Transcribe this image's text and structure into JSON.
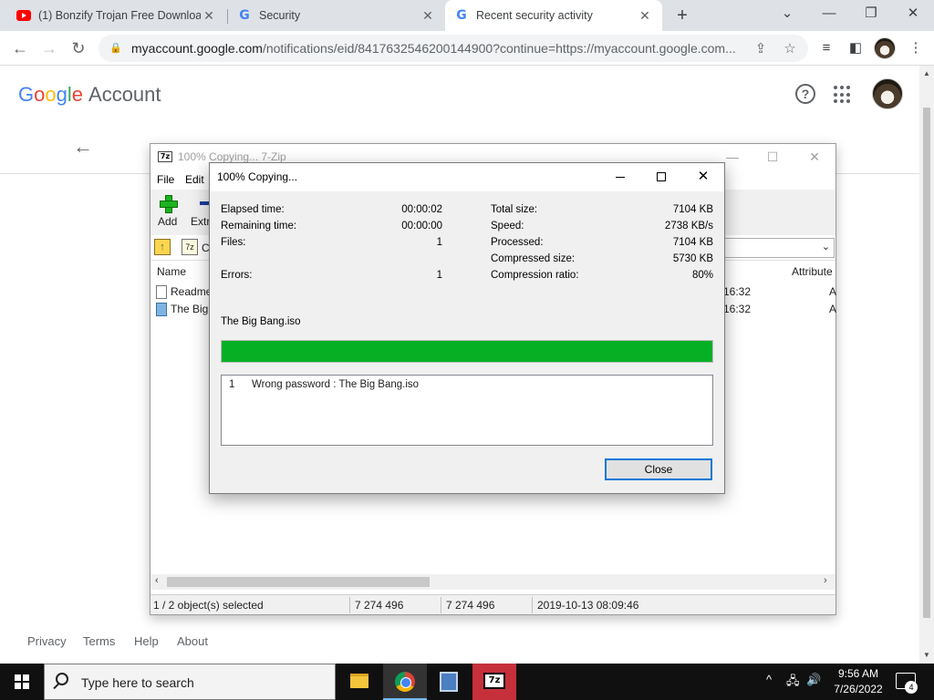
{
  "browser": {
    "tabs": [
      {
        "title": "(1) Bonzify Trojan Free Download",
        "icon": "youtube-icon",
        "active": false
      },
      {
        "title": "Security",
        "icon": "google-icon",
        "active": false
      },
      {
        "title": "Recent security activity",
        "icon": "google-icon",
        "active": true
      }
    ],
    "url_host": "myaccount.google.com",
    "url_path": "/notifications/eid/8417632546200144900?continue=https://myaccount.google.com..."
  },
  "page": {
    "logo": {
      "letters": [
        "G",
        "o",
        "o",
        "g",
        "l",
        "e"
      ],
      "suffix": "Account"
    },
    "footer": {
      "privacy": "Privacy",
      "terms": "Terms",
      "help": "Help",
      "about": "About"
    }
  },
  "zip_window": {
    "title": "100% Copying... 7-Zip",
    "logo": "7z",
    "menu": {
      "file": "File",
      "edit": "Edit"
    },
    "tools": {
      "add": "Add",
      "extract": "Extr"
    },
    "path_text": "C",
    "columns": {
      "name": "Name",
      "attributes": "Attribute"
    },
    "files": [
      {
        "name": "Readme",
        "time": "16:32",
        "attr": "A"
      },
      {
        "name": "The Big",
        "time": "16:32",
        "attr": "A"
      }
    ],
    "status": {
      "selected": "1 / 2 object(s) selected",
      "size": "7 274 496",
      "packed": "7 274 496",
      "modified": "2019-10-13 08:09:46"
    }
  },
  "dialog": {
    "title": "100% Copying...",
    "elapsed_label": "Elapsed time:",
    "elapsed_value": "00:00:02",
    "remaining_label": "Remaining time:",
    "remaining_value": "00:00:00",
    "files_label": "Files:",
    "files_value": "1",
    "errors_label": "Errors:",
    "errors_value": "1",
    "total_label": "Total size:",
    "total_value": "7104 KB",
    "speed_label": "Speed:",
    "speed_value": "2738 KB/s",
    "processed_label": "Processed:",
    "processed_value": "7104 KB",
    "compressed_label": "Compressed size:",
    "compressed_value": "5730 KB",
    "ratio_label": "Compression ratio:",
    "ratio_value": "80%",
    "current_file": "The Big Bang.iso",
    "progress_percent": 100,
    "progress_color": "#06b025",
    "log": [
      {
        "num": "1",
        "message": "Wrong password : The Big Bang.iso"
      }
    ],
    "close_label": "Close"
  },
  "taskbar": {
    "search_placeholder": "Type here to search",
    "time": "9:56 AM",
    "date": "7/26/2022",
    "notification_count": "4",
    "zip_label": "7z"
  }
}
